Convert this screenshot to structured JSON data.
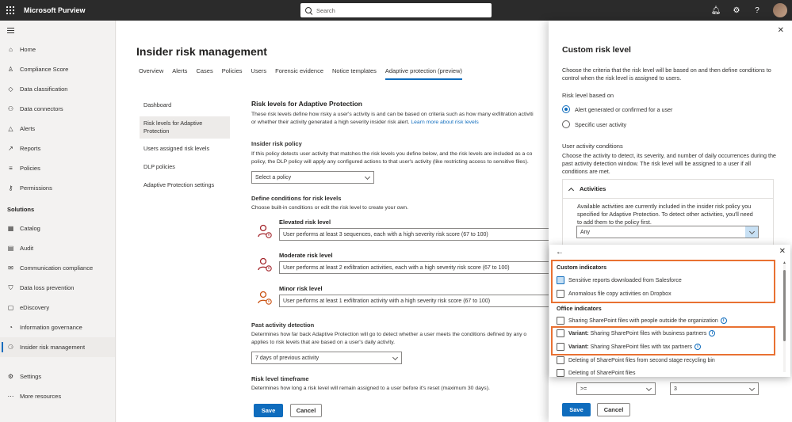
{
  "topbar": {
    "app_name": "Microsoft Purview",
    "search_placeholder": "Search",
    "icons": [
      "bell-icon",
      "gear-icon",
      "help-icon"
    ]
  },
  "leftnav": {
    "items": [
      {
        "label": "Home",
        "icon": "⌂"
      },
      {
        "label": "Compliance Score",
        "icon": "♙"
      },
      {
        "label": "Data classification",
        "icon": "◇"
      },
      {
        "label": "Data connectors",
        "icon": "⚇"
      },
      {
        "label": "Alerts",
        "icon": "△"
      },
      {
        "label": "Reports",
        "icon": "↗"
      },
      {
        "label": "Policies",
        "icon": "≡"
      },
      {
        "label": "Permissions",
        "icon": "⚷"
      }
    ],
    "section": "Solutions",
    "solutions": [
      {
        "label": "Catalog",
        "icon": "▦"
      },
      {
        "label": "Audit",
        "icon": "▤"
      },
      {
        "label": "Communication compliance",
        "icon": "✉"
      },
      {
        "label": "Data loss prevention",
        "icon": "⛉"
      },
      {
        "label": "eDiscovery",
        "icon": "▢"
      },
      {
        "label": "Information governance",
        "icon": "◔"
      },
      {
        "label": "Insider risk management",
        "icon": "⚆"
      }
    ],
    "bottom": [
      {
        "label": "Settings",
        "icon": "⚙"
      },
      {
        "label": "More resources",
        "icon": "⋯"
      }
    ]
  },
  "main": {
    "title": "Insider risk management",
    "tabs": [
      "Overview",
      "Alerts",
      "Cases",
      "Policies",
      "Users",
      "Forensic evidence",
      "Notice templates",
      "Adaptive protection (preview)"
    ],
    "subnav": [
      "Dashboard",
      "Risk levels for Adaptive Protection",
      "Users assigned risk levels",
      "DLP policies",
      "Adaptive Protection settings"
    ],
    "section_title": "Risk levels for Adaptive Protection",
    "section_desc_1": "These risk levels define how risky a user's activity is and can be based on criteria such as how many exfiltration activiti",
    "section_desc_2a": "or whether their activity generated a high severity insider risk alert. ",
    "section_desc_link": "Learn more about risk levels",
    "policy_label": "Insider risk policy",
    "policy_desc_1": "If this policy detects user activity that matches the risk levels you define below, and the risk levels are included as a co",
    "policy_desc_2": "policy, the DLP policy will apply any configured actions to that user's activity (like restricting access to sensitive files).",
    "policy_select": "Select a policy",
    "conditions_label": "Define conditions for risk levels",
    "conditions_desc": "Choose built-in conditions or edit the risk level to create your own.",
    "risk_levels": [
      {
        "name": "Elevated risk level",
        "value": "User performs at least 3 sequences, each with a high severity risk score (67 to 100)",
        "color": "#a4262c"
      },
      {
        "name": "Moderate risk level",
        "value": "User performs at least 2 exfiltration activities, each with a high severity risk score (67 to 100)",
        "color": "#a4262c"
      },
      {
        "name": "Minor risk level",
        "value": "User performs at least 1 exfiltration activity with a high severity risk score (67 to 100)",
        "color": "#ca5010"
      }
    ],
    "past_label": "Past activity detection",
    "past_desc_1": "Determines how far back Adaptive Protection will go to detect whether a user meets the conditions defined by any o",
    "past_desc_2": "applies to risk levels that are based on a user's daily activity.",
    "past_select": "7 days of previous activity",
    "timeframe_label": "Risk level timeframe",
    "timeframe_desc": "Determines how long a risk level will remain assigned to a user before it's reset (maximum 30 days).",
    "save": "Save",
    "cancel": "Cancel"
  },
  "panel": {
    "title": "Custom risk level",
    "desc": "Choose the criteria that the risk level will be based on and then define conditions to control when the risk level is assigned to users.",
    "based_on_label": "Risk level based on",
    "radio_1": "Alert generated or confirmed for a user",
    "radio_2": "Specific user activity",
    "uac_label": "User activity conditions",
    "uac_desc": "Choose the activity to detect, its severity, and number of daily occurrences during the past activity detection window. The risk level will be assigned to a user if all conditions are met.",
    "activities_label": "Activities",
    "activities_desc": "Available activities are currently included in the insider risk policy you specified for Adaptive Protection. To detect other activities, you'll need to add them to the policy first.",
    "activity_select": "Any",
    "op_select": ">=",
    "count_select": "3",
    "save": "Save",
    "cancel": "Cancel"
  },
  "popup": {
    "custom_label": "Custom indicators",
    "custom_items": [
      "Sensitive reports downloaded from Salesforce",
      "Anomalous file copy activities on Dropbox"
    ],
    "office_label": "Office indicators",
    "office_item_1": "Sharing SharePoint files with people outside the organization",
    "variant_prefix": "Variant:",
    "variant_1": "Sharing SharePoint files with business partners",
    "variant_2": "Sharing SharePoint files with tax partners",
    "office_item_2": "Deleting of SharePoint files from second stage recycling bin",
    "office_item_3": "Deleting of SharePoint files",
    "highlight_color": "#e97132"
  }
}
